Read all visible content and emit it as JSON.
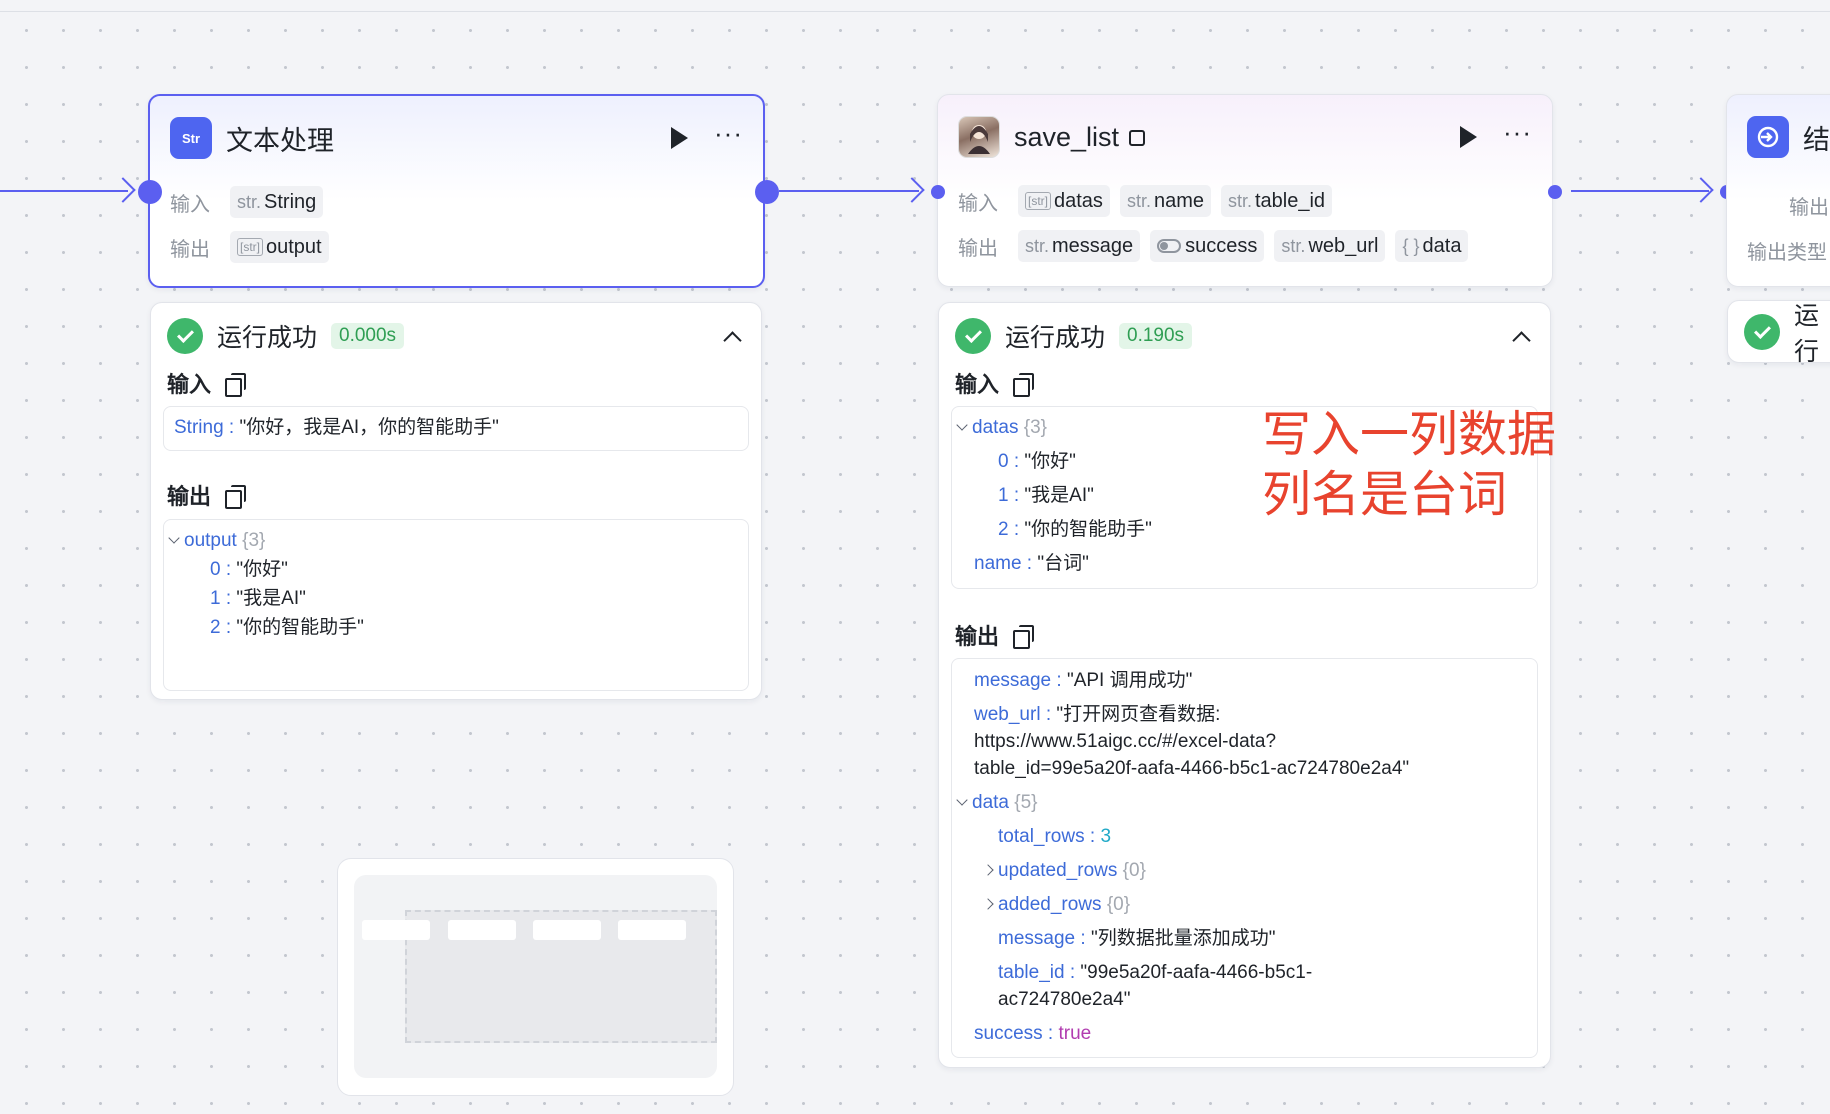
{
  "nodes": {
    "text_process": {
      "icon": "Str",
      "title": "文本处理",
      "input_label": "输入",
      "output_label": "输出",
      "inputs": [
        {
          "type": "str.",
          "name": "String"
        }
      ],
      "outputs": [
        {
          "type": "[str]",
          "name": "output"
        }
      ],
      "run": {
        "status": "运行成功",
        "time": "0.000s",
        "input_title": "输入",
        "output_title": "输出",
        "input_key": "String",
        "input_value": "\"你好，我是AI，你的智能助手\"",
        "output_key": "output",
        "output_count": "{3}",
        "output_items": [
          {
            "k": "0",
            "v": "\"你好\""
          },
          {
            "k": "1",
            "v": "\"我是AI\""
          },
          {
            "k": "2",
            "v": "\"你的智能助手\""
          }
        ]
      }
    },
    "save_list": {
      "title": "save_list",
      "input_label": "输入",
      "output_label": "输出",
      "inputs": [
        {
          "type": "[str]",
          "name": "datas"
        },
        {
          "type": "str.",
          "name": "name"
        },
        {
          "type": "str.",
          "name": "table_id"
        }
      ],
      "outputs": [
        {
          "type": "str.",
          "name": "message"
        },
        {
          "type": "toggle",
          "name": "success"
        },
        {
          "type": "str.",
          "name": "web_url"
        },
        {
          "type": "{ }",
          "name": "data"
        }
      ],
      "run": {
        "status": "运行成功",
        "time": "0.190s",
        "input_title": "输入",
        "output_title": "输出",
        "in_datas_key": "datas",
        "in_datas_count": "{3}",
        "in_datas_items": [
          {
            "k": "0",
            "v": "\"你好\""
          },
          {
            "k": "1",
            "v": "\"我是AI\""
          },
          {
            "k": "2",
            "v": "\"你的智能助手\""
          }
        ],
        "in_name_key": "name",
        "in_name_value": "\"台词\"",
        "out_message_key": "message",
        "out_message_value": "\"API 调用成功\"",
        "out_weburl_key": "web_url",
        "out_weburl_line1": "\"打开网页查看数据:",
        "out_weburl_line2": "https://www.51aigc.cc/#/excel-data?",
        "out_weburl_line3": "table_id=99e5a20f-aafa-4466-b5c1-ac724780e2a4\"",
        "out_data_key": "data",
        "out_data_count": "{5}",
        "total_rows_key": "total_rows",
        "total_rows_value": "3",
        "updated_rows_key": "updated_rows",
        "updated_rows_count": "{0}",
        "added_rows_key": "added_rows",
        "added_rows_count": "{0}",
        "data_message_key": "message",
        "data_message_value": "\"列数据批量添加成功\"",
        "table_id_key": "table_id",
        "table_id_line1": "\"99e5a20f-aafa-4466-b5c1-",
        "table_id_line2": "ac724780e2a4\"",
        "success_key": "success",
        "success_value": "true"
      }
    },
    "end_node": {
      "title": "结",
      "output_label": "输出",
      "output_type_label": "输出类型",
      "run_status": "运行"
    }
  },
  "annotation": {
    "line1": "写入一列数据",
    "line2": "列名是台词"
  },
  "colors": {
    "accent": "#5b5ff0",
    "success": "#3fb76b",
    "annotation": "#e8432e",
    "json_key": "#3d6bd8"
  },
  "icons": [
    "str-icon",
    "avatar",
    "play-icon",
    "more-icon",
    "check-circle-icon",
    "chevron-up-icon",
    "copy-icon",
    "exit-icon",
    "db-icon"
  ]
}
